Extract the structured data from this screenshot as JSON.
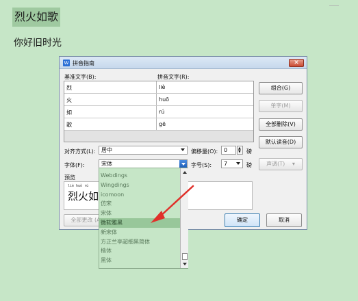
{
  "document": {
    "line1": "烈火如歌",
    "line2": "你好旧时光"
  },
  "dialog": {
    "app_icon": "W",
    "title": "拼音指南",
    "close_glyph": "✕",
    "base_text_header": "基准文字(B):",
    "pinyin_text_header": "拼音文字(R):",
    "rows": [
      {
        "base": "烈",
        "pinyin": "liè"
      },
      {
        "base": "火",
        "pinyin": "huō"
      },
      {
        "base": "如",
        "pinyin": "rú"
      },
      {
        "base": "歌",
        "pinyin": "gē"
      }
    ],
    "buttons": {
      "combine": "组合(G)",
      "single": "单字(M)",
      "delete_all": "全部删除(V)",
      "default_reading": "默认读音(D)",
      "tone": "声调(T)",
      "apply_all": "全部更改 (A",
      "ok": "确定",
      "cancel": "取消"
    },
    "align_label": "对齐方式(L):",
    "align_value": "居中",
    "offset_label": "偏移量(O):",
    "offset_value": "0",
    "offset_unit": "磅",
    "font_label": "字体(F):",
    "font_value": "宋体",
    "size_label": "字号(S):",
    "size_value": "7",
    "size_unit": "磅",
    "preview_label": "预览",
    "preview_pinyin": "liè huǒ rú",
    "preview_text": "烈火如",
    "tone_dropdown_icon": "chevron-down-icon"
  },
  "font_dropdown": {
    "items": [
      "Webdings",
      "Wingdings",
      "icomoon",
      "仿宋",
      "宋体",
      "微软雅黑",
      "新宋体",
      "方正兰亭超细黑简体",
      "楷体",
      "黑体"
    ],
    "selected_index": 5
  },
  "colors": {
    "background": "#c6e6c7",
    "annotation_arrow": "#e0302a",
    "selected_item": "#98c79a"
  }
}
